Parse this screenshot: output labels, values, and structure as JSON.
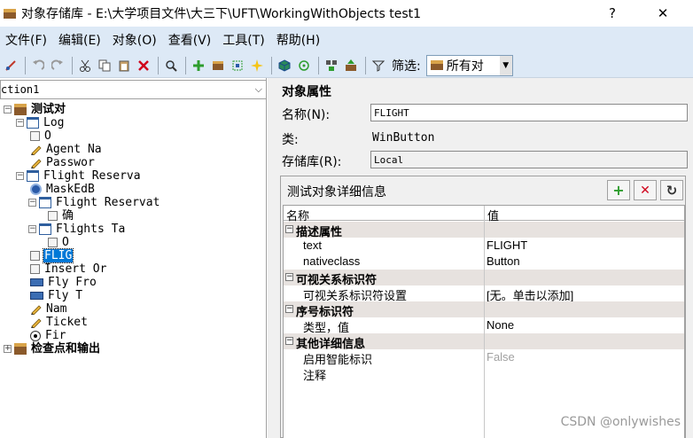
{
  "window": {
    "title": "对象存储库 - E:\\大学项目文件\\大三下\\UFT\\WorkingWithObjects test1",
    "help_button": "?",
    "close_button": "✕"
  },
  "menu": [
    "文件(F)",
    "编辑(E)",
    "对象(O)",
    "查看(V)",
    "工具(T)",
    "帮助(H)"
  ],
  "toolbar": {
    "filter_label": "筛选:",
    "filter_value": "所有对",
    "icons": [
      "pin-icon",
      "undo-icon",
      "redo-icon",
      "cut-icon",
      "copy-icon",
      "paste-icon",
      "delete-icon",
      "find-icon",
      "add-object-icon",
      "chest-icon",
      "capture-icon",
      "highlight-icon",
      "cube-icon",
      "locate-icon",
      "group-icon",
      "export-icon",
      "filter-icon"
    ]
  },
  "left": {
    "combo_value": "ction1",
    "tree": [
      {
        "label": "测试对",
        "bold": true,
        "icon": "chest",
        "expander": "minus",
        "level": 0
      },
      {
        "label": "Log",
        "icon": "win",
        "expander": "minus",
        "level": 1
      },
      {
        "label": "O",
        "icon": "check",
        "level": 2
      },
      {
        "label": "Agent Na",
        "icon": "pencil",
        "level": 2
      },
      {
        "label": "Passwor",
        "icon": "pencil",
        "level": 2
      },
      {
        "label": "Flight Reserva",
        "icon": "win",
        "expander": "minus",
        "level": 1
      },
      {
        "label": "MaskEdB",
        "icon": "gear",
        "level": 2
      },
      {
        "label": "Flight Reservat",
        "icon": "win",
        "expander": "minus",
        "level": 2
      },
      {
        "label": "确",
        "icon": "check",
        "level": 3
      },
      {
        "label": "Flights Ta",
        "icon": "win",
        "expander": "minus",
        "level": 2
      },
      {
        "label": "O",
        "icon": "check",
        "level": 3
      },
      {
        "label": "FLIG",
        "icon": "check",
        "level": 2,
        "selected": true
      },
      {
        "label": "Insert Or",
        "icon": "check",
        "level": 2
      },
      {
        "label": "Fly Fro",
        "icon": "button",
        "level": 2
      },
      {
        "label": "Fly T",
        "icon": "button",
        "level": 2
      },
      {
        "label": "Nam",
        "icon": "pencil",
        "level": 2
      },
      {
        "label": "Ticket",
        "icon": "pencil",
        "level": 2
      },
      {
        "label": "Fir",
        "icon": "radio",
        "level": 2
      },
      {
        "label": "检查点和输出",
        "bold": true,
        "icon": "chest",
        "expander": "plus",
        "level": 0
      }
    ]
  },
  "properties": {
    "heading": "对象属性",
    "name_label": "名称(N):",
    "name_value": "FLIGHT",
    "class_label": "类:",
    "class_value": "WinButton",
    "repo_label": "存储库(R):",
    "repo_value": "Local",
    "details_title": "测试对象详细信息",
    "buttons": {
      "add": "+",
      "remove": "✕",
      "refresh": "↻"
    },
    "grid_headers": {
      "name": "名称",
      "value": "值"
    },
    "rows": [
      {
        "type": "cat",
        "name": "描述属性",
        "value": ""
      },
      {
        "type": "prop",
        "name": "text",
        "value": "FLIGHT"
      },
      {
        "type": "prop",
        "name": "nativeclass",
        "value": "Button"
      },
      {
        "type": "cat",
        "name": "可视关系标识符",
        "value": ""
      },
      {
        "type": "prop",
        "name": "可视关系标识符设置",
        "value": "[无。单击以添加]"
      },
      {
        "type": "cat",
        "name": "序号标识符",
        "value": ""
      },
      {
        "type": "prop",
        "name": "类型，值",
        "value": "None"
      },
      {
        "type": "cat",
        "name": "其他详细信息",
        "value": ""
      },
      {
        "type": "prop",
        "name": "启用智能标识",
        "value": "False",
        "dim": true
      },
      {
        "type": "prop",
        "name": "注释",
        "value": ""
      }
    ]
  },
  "watermark": "CSDN @onlywishes"
}
